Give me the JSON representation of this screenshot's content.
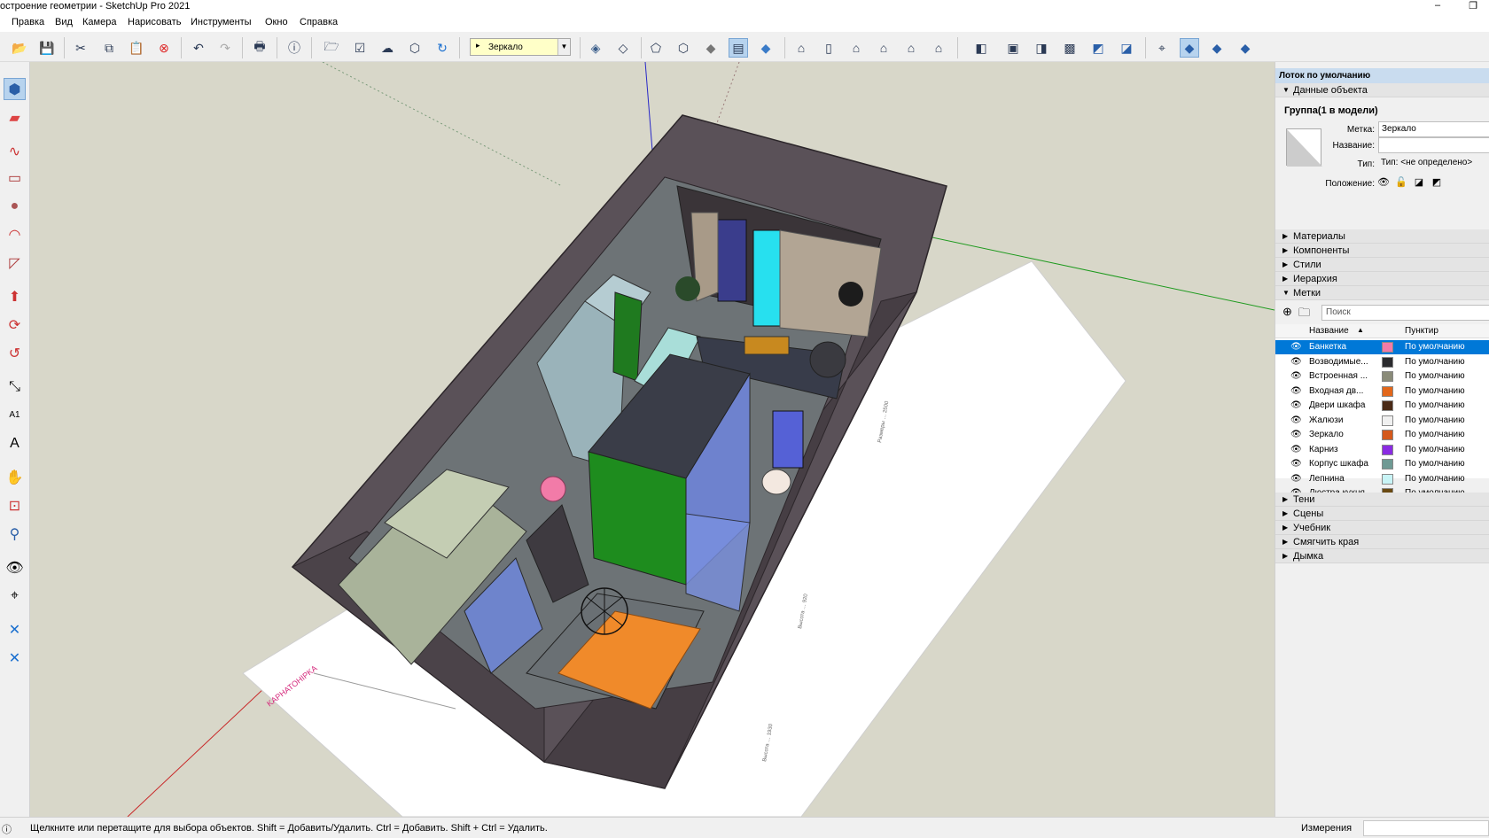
{
  "window": {
    "title": "остроение геометрии - SketchUp Pro 2021",
    "restore_glyph": "❐"
  },
  "menu": [
    "Правка",
    "Вид",
    "Камера",
    "Нарисовать",
    "Инструменты",
    "Окно",
    "Справка"
  ],
  "toolbar": {
    "layer_current": "Зеркало"
  },
  "tray": {
    "title": "Лоток по умолчанию",
    "entity_info": {
      "section": "Данные объекта",
      "group_title": "Группа(1 в модели)",
      "tag_label": "Метка:",
      "tag_value": "Зеркало",
      "name_label": "Название:",
      "name_value": "",
      "type_label": "Тип:",
      "type_value": "Тип: <не определено>",
      "position_label": "Положение:"
    },
    "collapsed_sections": [
      "Материалы",
      "Компоненты",
      "Стили",
      "Иерархия"
    ],
    "tags": {
      "section": "Метки",
      "search_placeholder": "Поиск",
      "col_name": "Название",
      "col_dash": "Пунктир",
      "rows": [
        {
          "name": "Банкетка",
          "color": "#f27ba8",
          "dash": "По умолчанию",
          "selected": true
        },
        {
          "name": "Возводимые...",
          "color": "#2b2b2e",
          "dash": "По умолчанию"
        },
        {
          "name": "Встроенная ...",
          "color": "#8a8b79",
          "dash": "По умолчанию"
        },
        {
          "name": "Входная дв...",
          "color": "#e2671b",
          "dash": "По умолчанию"
        },
        {
          "name": "Двери шкафа",
          "color": "#4a2a16",
          "dash": "По умолчанию"
        },
        {
          "name": "Жалюзи",
          "color": "#f0f0f0",
          "dash": "По умолчанию"
        },
        {
          "name": "Зеркало",
          "color": "#d4591c",
          "dash": "По умолчанию"
        },
        {
          "name": "Карниз",
          "color": "#8a2be2",
          "dash": "По умолчанию"
        },
        {
          "name": "Корпус шкафа",
          "color": "#6f9a94",
          "dash": "По умолчанию"
        },
        {
          "name": "Лепнина",
          "color": "#c8f4f6",
          "dash": "По умолчанию"
        },
        {
          "name": "Люстра кухня",
          "color": "#6a4a12",
          "dash": "По умолчанию"
        }
      ]
    },
    "lower_sections": [
      "Тени",
      "Сцены",
      "Учебник",
      "Смягчить края",
      "Дымка"
    ]
  },
  "status": {
    "message": "Щелкните или перетащите для выбора объектов. Shift = Добавить/Удалить. Ctrl = Добавить. Shift + Ctrl = Удалить.",
    "measure_label": "Измерения",
    "measure_value": ""
  },
  "viewport": {
    "floorplan_brand": "KAPHATOHIPKA"
  }
}
